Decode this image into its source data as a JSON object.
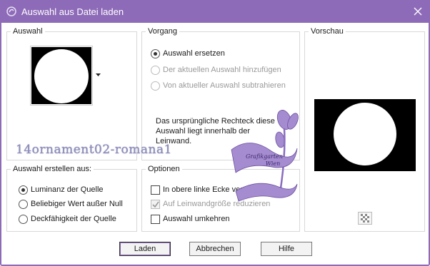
{
  "window": {
    "title": "Auswahl aus Datei laden"
  },
  "auswahl": {
    "group_label": "Auswahl"
  },
  "vorgang": {
    "group_label": "Vorgang",
    "options": [
      {
        "label": "Auswahl ersetzen",
        "checked": true,
        "disabled": false
      },
      {
        "label": "Der aktuellen Auswahl hinzufügen",
        "checked": false,
        "disabled": true
      },
      {
        "label": "Von aktueller Auswahl subtrahieren",
        "checked": false,
        "disabled": true
      }
    ],
    "info_text_line1": "Das ursprüngliche Rechteck diese",
    "info_text_line2": "Auswahl liegt innerhalb der",
    "info_text_line3": "Leinwand."
  },
  "vorschau": {
    "group_label": "Vorschau"
  },
  "erstellen": {
    "group_label": "Auswahl erstellen aus:",
    "options": [
      {
        "label": "Luminanz der Quelle",
        "checked": true
      },
      {
        "label": "Beliebiger Wert außer Null",
        "checked": false
      },
      {
        "label": "Deckfähigkeit der Quelle",
        "checked": false
      }
    ]
  },
  "optionen": {
    "group_label": "Optionen",
    "items": [
      {
        "label": "In obere linke Ecke verschieben",
        "checked": false,
        "disabled": false
      },
      {
        "label": "Auf Leinwandgröße reduzieren",
        "checked": true,
        "disabled": true
      },
      {
        "label": "Auswahl umkehren",
        "checked": false,
        "disabled": false
      }
    ]
  },
  "buttons": {
    "ok": "Laden",
    "cancel": "Abbrechen",
    "help": "Hilfe"
  },
  "watermark": {
    "text": "14ornament02-romana1",
    "badge_line1": "Grafikgarten",
    "badge_line2": "Wien"
  },
  "colors": {
    "accent": "#8e6bb8",
    "watermark": "#a58bd0"
  }
}
